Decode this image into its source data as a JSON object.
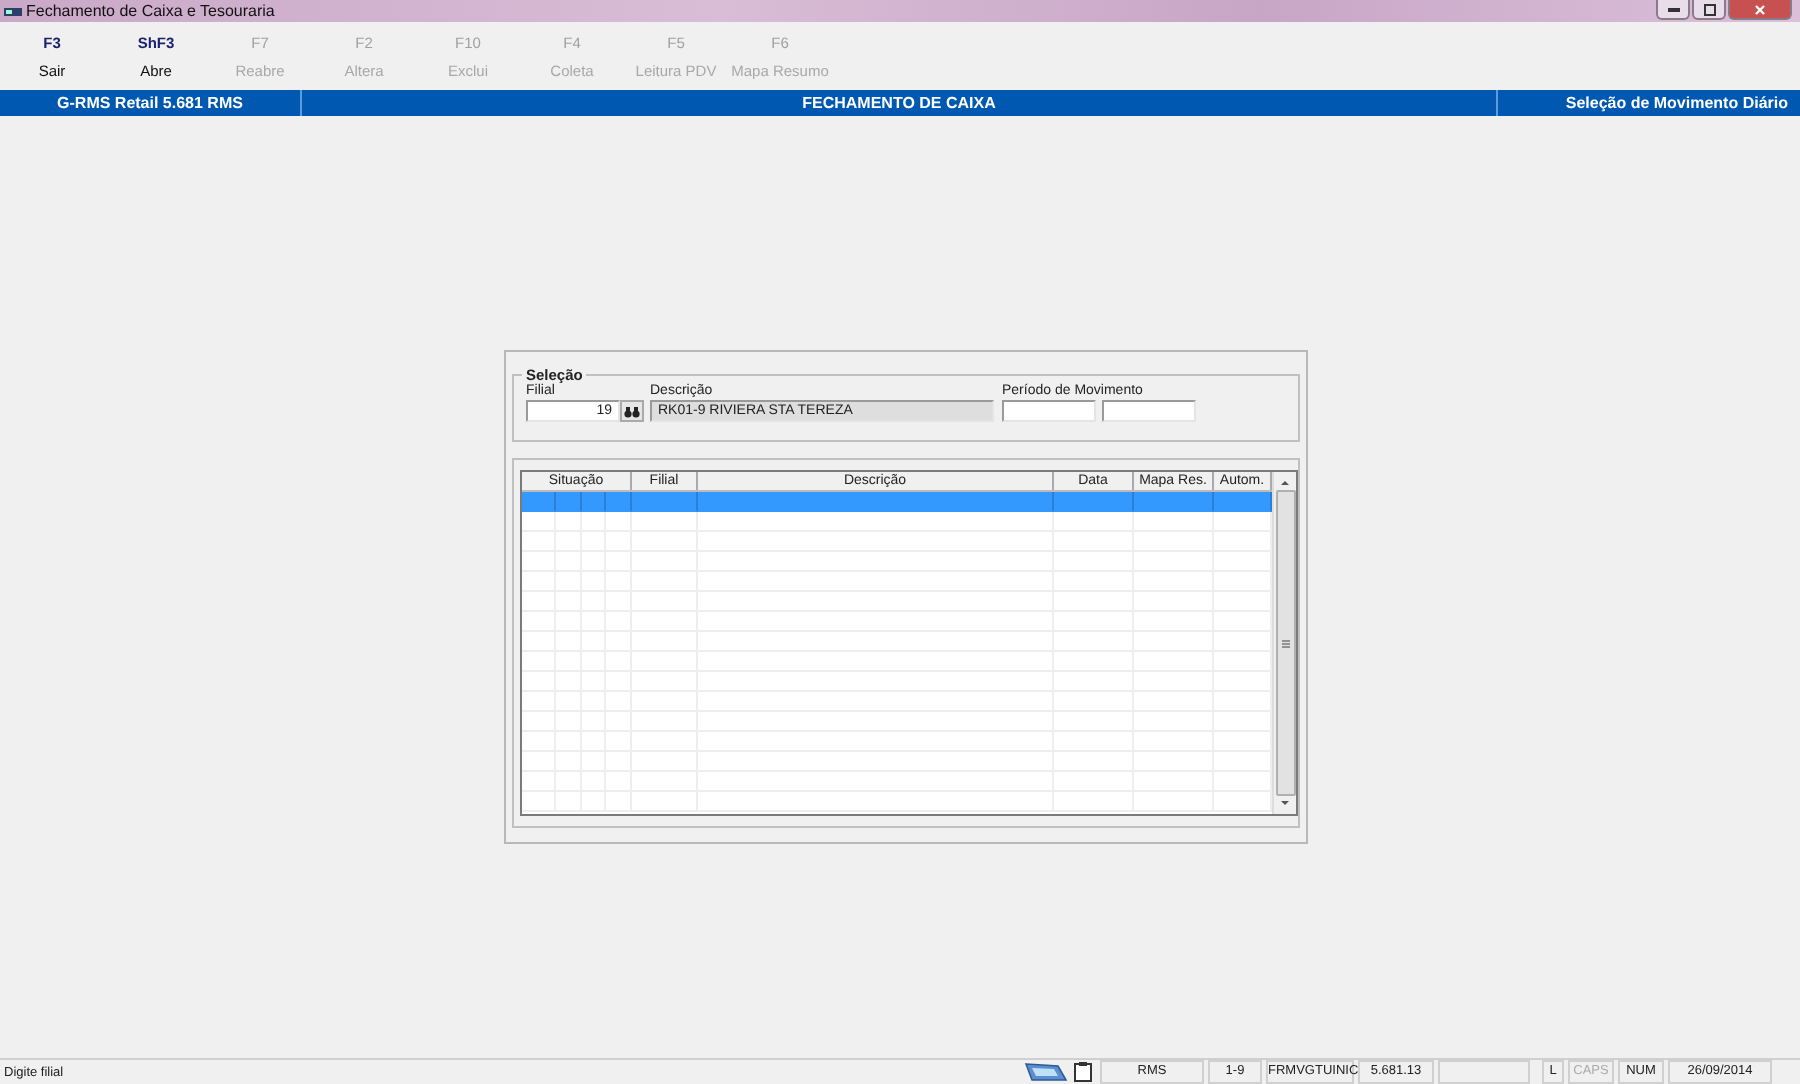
{
  "window": {
    "title": "Fechamento de Caixa e Tesouraria"
  },
  "toolbar": [
    {
      "key": "F3",
      "label": "Sair",
      "disabled": false
    },
    {
      "key": "ShF3",
      "label": "Abre",
      "disabled": false
    },
    {
      "key": "F7",
      "label": "Reabre",
      "disabled": true
    },
    {
      "key": "F2",
      "label": "Altera",
      "disabled": true
    },
    {
      "key": "F10",
      "label": "Exclui",
      "disabled": true
    },
    {
      "key": "F4",
      "label": "Coleta",
      "disabled": true
    },
    {
      "key": "F5",
      "label": "Leitura PDV",
      "disabled": true
    },
    {
      "key": "F6",
      "label": "Mapa Resumo",
      "disabled": true
    }
  ],
  "header": {
    "left": "G-RMS Retail 5.681 RMS",
    "center": "FECHAMENTO DE CAIXA",
    "right": "Seleção de Movimento Diário"
  },
  "selection": {
    "title": "Seleção",
    "filial_label": "Filial",
    "filial_value": "19",
    "descricao_label": "Descrição",
    "descricao_value": "RK01-9 RIVIERA STA TEREZA",
    "periodo_label": "Período de Movimento"
  },
  "table": {
    "columns": [
      {
        "label": "Situação"
      },
      {
        "label": "Filial"
      },
      {
        "label": "Descrição"
      },
      {
        "label": "Data"
      },
      {
        "label": "Mapa Res."
      },
      {
        "label": "Autom."
      }
    ],
    "rows": [
      {
        "selected": true
      },
      {
        "selected": false
      },
      {
        "selected": false
      },
      {
        "selected": false
      },
      {
        "selected": false
      },
      {
        "selected": false
      },
      {
        "selected": false
      },
      {
        "selected": false
      },
      {
        "selected": false
      },
      {
        "selected": false
      },
      {
        "selected": false
      },
      {
        "selected": false
      },
      {
        "selected": false
      },
      {
        "selected": false
      },
      {
        "selected": false
      },
      {
        "selected": false
      }
    ]
  },
  "status_bar": {
    "message": "Digite filial",
    "fields": [
      {
        "text": "RMS",
        "dim": false
      },
      {
        "text": "1-9",
        "dim": false
      },
      {
        "text": "FRMVGTUINIC",
        "dim": false
      },
      {
        "text": "5.681.13",
        "dim": false
      }
    ],
    "keys": [
      {
        "text": "L",
        "dim": false
      },
      {
        "text": "CAPS",
        "dim": true
      },
      {
        "text": "NUM",
        "dim": false
      }
    ],
    "date": "26/09/2014"
  }
}
